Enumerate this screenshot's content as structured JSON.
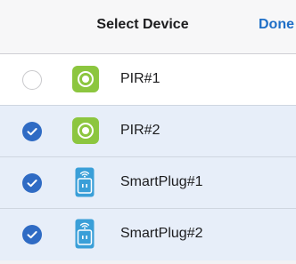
{
  "navbar": {
    "title": "Select Device",
    "done_label": "Done"
  },
  "colors": {
    "accent": "#2f6bc4",
    "selected_row": "#e7eef9",
    "pir_green": "#8cc63f",
    "plug_blue": "#3a9fd8"
  },
  "devices": [
    {
      "label": "PIR#1",
      "icon": "pir-sensor-icon",
      "selected": false
    },
    {
      "label": "PIR#2",
      "icon": "pir-sensor-icon",
      "selected": true
    },
    {
      "label": "SmartPlug#1",
      "icon": "smart-plug-icon",
      "selected": true
    },
    {
      "label": "SmartPlug#2",
      "icon": "smart-plug-icon",
      "selected": true
    }
  ]
}
